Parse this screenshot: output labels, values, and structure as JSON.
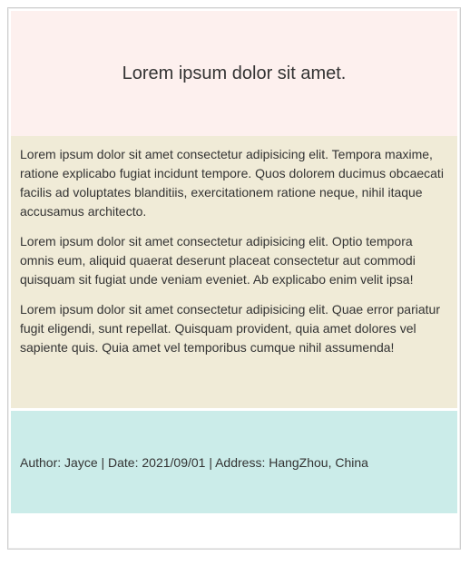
{
  "header": {
    "title": "Lorem ipsum dolor sit amet."
  },
  "main": {
    "paragraphs": [
      "Lorem ipsum dolor sit amet consectetur adipisicing elit. Tempora maxime, ratione explicabo fugiat incidunt tempore. Quos dolorem ducimus obcaecati facilis ad voluptates blanditiis, exercitationem ratione neque, nihil itaque accusamus architecto.",
      "Lorem ipsum dolor sit amet consectetur adipisicing elit. Optio tempora omnis eum, aliquid quaerat deserunt placeat consectetur aut commodi quisquam sit fugiat unde veniam eveniet. Ab explicabo enim velit ipsa!",
      "Lorem ipsum dolor sit amet consectetur adipisicing elit. Quae error pariatur fugit eligendi, sunt repellat. Quisquam provident, quia amet dolores vel sapiente quis. Quia amet vel temporibus cumque nihil assumenda!"
    ]
  },
  "footer": {
    "info": "Author: Jayce | Date: 2021/09/01 | Address: HangZhou, China"
  },
  "colors": {
    "header_bg": "#fdf0ee",
    "main_bg": "#f0ebd7",
    "footer_bg": "#cbece9",
    "text": "#333333"
  }
}
